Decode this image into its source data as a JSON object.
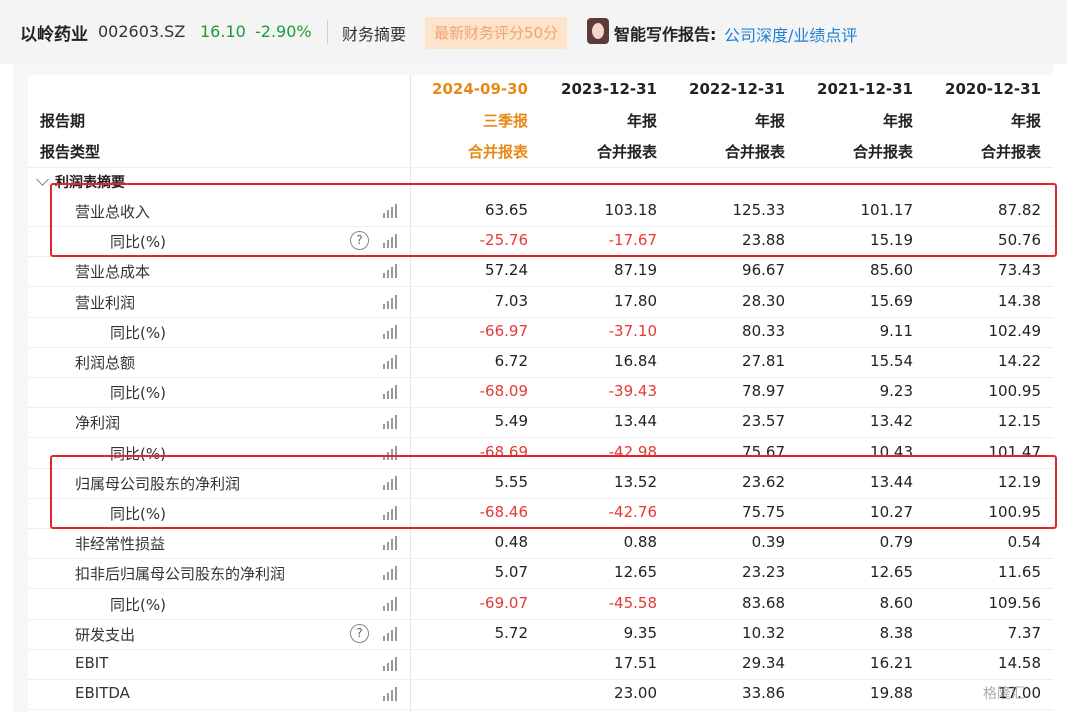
{
  "header": {
    "company": "以岭药业",
    "code": "002603.SZ",
    "price": "16.10",
    "change": "-2.90%",
    "summary_link": "财务摘要",
    "score_badge": "最新财务评分50分",
    "ai_label": "智能写作报告:",
    "ai_links": "公司深度/业绩点评"
  },
  "table": {
    "row_header_labels": [
      "报告期",
      "报告类型"
    ],
    "columns": [
      {
        "date": "2024-09-30",
        "period": "三季报",
        "type": "合并报表",
        "highlight": true
      },
      {
        "date": "2023-12-31",
        "period": "年报",
        "type": "合并报表",
        "highlight": false
      },
      {
        "date": "2022-12-31",
        "period": "年报",
        "type": "合并报表",
        "highlight": false
      },
      {
        "date": "2021-12-31",
        "period": "年报",
        "type": "合并报表",
        "highlight": false
      },
      {
        "date": "2020-12-31",
        "period": "年报",
        "type": "合并报表",
        "highlight": false
      }
    ],
    "section_title": "利润表摘要",
    "rows": [
      {
        "label": "营业总收入",
        "indent": 0,
        "help": false,
        "values": [
          "63.65",
          "103.18",
          "125.33",
          "101.17",
          "87.82"
        ]
      },
      {
        "label": "同比(%)",
        "indent": 1,
        "help": true,
        "values": [
          "-25.76",
          "-17.67",
          "23.88",
          "15.19",
          "50.76"
        ]
      },
      {
        "label": "营业总成本",
        "indent": 0,
        "help": false,
        "values": [
          "57.24",
          "87.19",
          "96.67",
          "85.60",
          "73.43"
        ]
      },
      {
        "label": "营业利润",
        "indent": 0,
        "help": false,
        "values": [
          "7.03",
          "17.80",
          "28.30",
          "15.69",
          "14.38"
        ]
      },
      {
        "label": "同比(%)",
        "indent": 1,
        "help": false,
        "values": [
          "-66.97",
          "-37.10",
          "80.33",
          "9.11",
          "102.49"
        ]
      },
      {
        "label": "利润总额",
        "indent": 0,
        "help": false,
        "values": [
          "6.72",
          "16.84",
          "27.81",
          "15.54",
          "14.22"
        ]
      },
      {
        "label": "同比(%)",
        "indent": 1,
        "help": false,
        "values": [
          "-68.09",
          "-39.43",
          "78.97",
          "9.23",
          "100.95"
        ]
      },
      {
        "label": "净利润",
        "indent": 0,
        "help": false,
        "values": [
          "5.49",
          "13.44",
          "23.57",
          "13.42",
          "12.15"
        ]
      },
      {
        "label": "同比(%)",
        "indent": 1,
        "help": false,
        "values": [
          "-68.69",
          "-42.98",
          "75.67",
          "10.43",
          "101.47"
        ]
      },
      {
        "label": "归属母公司股东的净利润",
        "indent": 0,
        "help": false,
        "values": [
          "5.55",
          "13.52",
          "23.62",
          "13.44",
          "12.19"
        ]
      },
      {
        "label": "同比(%)",
        "indent": 1,
        "help": false,
        "values": [
          "-68.46",
          "-42.76",
          "75.75",
          "10.27",
          "100.95"
        ]
      },
      {
        "label": "非经常性损益",
        "indent": 0,
        "help": false,
        "values": [
          "0.48",
          "0.88",
          "0.39",
          "0.79",
          "0.54"
        ]
      },
      {
        "label": "扣非后归属母公司股东的净利润",
        "indent": 0,
        "help": false,
        "values": [
          "5.07",
          "12.65",
          "23.23",
          "12.65",
          "11.65"
        ]
      },
      {
        "label": "同比(%)",
        "indent": 1,
        "help": false,
        "values": [
          "-69.07",
          "-45.58",
          "83.68",
          "8.60",
          "109.56"
        ]
      },
      {
        "label": "研发支出",
        "indent": 0,
        "help": true,
        "values": [
          "5.72",
          "9.35",
          "10.32",
          "8.38",
          "7.37"
        ]
      },
      {
        "label": "EBIT",
        "indent": 0,
        "help": false,
        "values": [
          "",
          "17.51",
          "29.34",
          "16.21",
          "14.58"
        ]
      },
      {
        "label": "EBITDA",
        "indent": 0,
        "help": false,
        "values": [
          "",
          "23.00",
          "33.86",
          "19.88",
          "17.00"
        ]
      }
    ],
    "highlight_groups": [
      [
        0,
        1
      ],
      [
        9,
        10
      ]
    ]
  },
  "colors": {
    "positive_change": "#1a9c3a",
    "negative_value": "#e53935",
    "highlight_header": "#e58a17",
    "link": "#1e7fd8",
    "highlight_box": "#e3242b"
  },
  "icons": {
    "row_chart": "bar-chart-icon",
    "help": "question-circle-icon",
    "expand": "chevron-down-icon"
  },
  "watermark": "格隆汇"
}
